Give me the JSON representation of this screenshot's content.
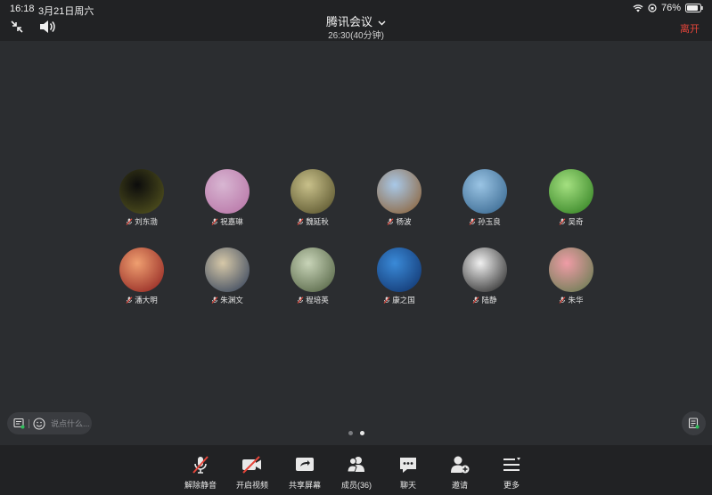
{
  "status_bar": {
    "time": "16:18",
    "date": "3月21日周六",
    "battery": "76%"
  },
  "meeting": {
    "title": "腾讯会议",
    "duration": "26:30(40分钟)",
    "leave_label": "离开"
  },
  "participants": [
    {
      "name": "刘东渤",
      "avatar_colors": [
        "#0c0c0c",
        "#5a5a20"
      ]
    },
    {
      "name": "祝嘉琳",
      "avatar_colors": [
        "#d8b6d2",
        "#b56fa3"
      ]
    },
    {
      "name": "魏延秋",
      "avatar_colors": [
        "#c8c08a",
        "#4f4a24"
      ]
    },
    {
      "name": "杨波",
      "avatar_colors": [
        "#a8c8e8",
        "#8a5a2a"
      ]
    },
    {
      "name": "孙玉良",
      "avatar_colors": [
        "#9ac4e4",
        "#2f5f88"
      ]
    },
    {
      "name": "吴奇",
      "avatar_colors": [
        "#a4e080",
        "#2a7a1c"
      ]
    },
    {
      "name": "潘大明",
      "avatar_colors": [
        "#ef9f70",
        "#8a1b1b"
      ]
    },
    {
      "name": "朱渊文",
      "avatar_colors": [
        "#d6c8a8",
        "#2a3a56"
      ]
    },
    {
      "name": "程培英",
      "avatar_colors": [
        "#c8d4b8",
        "#4a5a3a"
      ]
    },
    {
      "name": "康之国",
      "avatar_colors": [
        "#3a8ad8",
        "#0e2e66"
      ]
    },
    {
      "name": "陆静",
      "avatar_colors": [
        "#f0f0f0",
        "#1a1a1a"
      ]
    },
    {
      "name": "朱华",
      "avatar_colors": [
        "#ef9ca6",
        "#5c7a4a"
      ]
    }
  ],
  "chat": {
    "placeholder": "说点什么..."
  },
  "toolbar": {
    "unmute_label": "解除静音",
    "video_label": "开启视频",
    "share_label": "共享屏幕",
    "members_label": "成员(36)",
    "chat_label": "聊天",
    "invite_label": "邀请",
    "more_label": "更多"
  },
  "icons": {
    "mic": "mic-off-icon",
    "video": "video-off-icon",
    "share": "share-screen-icon",
    "members": "members-icon",
    "chat": "chat-icon",
    "invite": "invite-icon",
    "more": "more-icon"
  },
  "colors": {
    "accent_red": "#e5453a",
    "background": "#2b2d30",
    "bar": "#212224"
  }
}
